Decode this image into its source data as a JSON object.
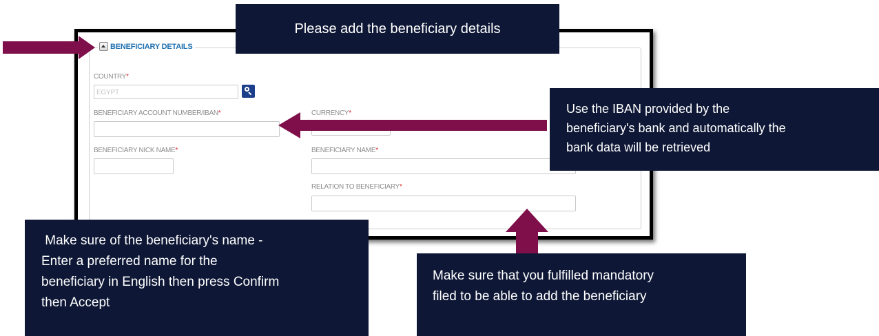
{
  "form": {
    "section_title": "BENEFICIARY DETAILS",
    "country": {
      "label": "COUNTRY",
      "value": "EGYPT"
    },
    "account": {
      "label": "BENEFICIARY ACCOUNT NUMBER/IBAN",
      "value": ""
    },
    "currency": {
      "label": "CURRENCY",
      "value": ""
    },
    "nickname": {
      "label": "BENEFICIARY NICK NAME",
      "value": ""
    },
    "name": {
      "label": "BENEFICIARY NAME",
      "value": ""
    },
    "relation": {
      "label": "RELATION TO BENEFICIARY",
      "value": ""
    },
    "required_marker": "*"
  },
  "callouts": {
    "top": "Please add the beneficiary details",
    "iban": [
      "Use the IBAN provided by the",
      "beneficiary's bank and automatically the",
      "bank data will be retrieved"
    ],
    "name": [
      " Make sure of the beneficiary's name -",
      "Enter a preferred name for the",
      "beneficiary in English then press Confirm",
      "then Accept"
    ],
    "mandatory": [
      "Make sure that you fulfilled mandatory",
      "filed to be able to add the beneficiary"
    ]
  },
  "colors": {
    "callout_bg": "#0e1836",
    "arrow": "#7f0f4b",
    "accent": "#1e6fb0",
    "required": "#d9262a"
  }
}
